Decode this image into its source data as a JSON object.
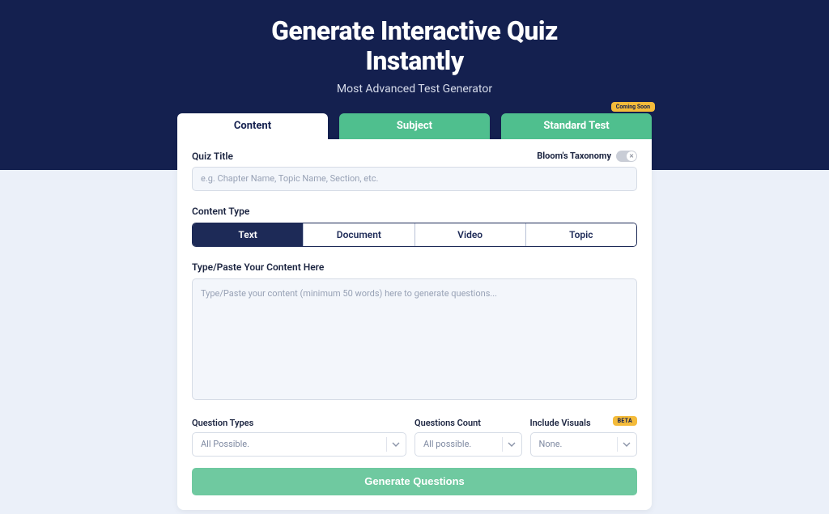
{
  "hero": {
    "title_line1": "Generate Interactive Quiz",
    "title_line2": "Instantly",
    "subtitle": "Most Advanced Test Generator"
  },
  "tabs": {
    "content": "Content",
    "subject": "Subject",
    "standard_test": "Standard Test",
    "coming_soon": "Coming Soon"
  },
  "form": {
    "quiz_title_label": "Quiz Title",
    "quiz_title_placeholder": "e.g. Chapter Name, Topic Name, Section, etc.",
    "bloom_label": "Bloom's Taxonomy",
    "content_type_label": "Content Type",
    "content_types": {
      "text": "Text",
      "document": "Document",
      "video": "Video",
      "topic": "Topic"
    },
    "paste_label": "Type/Paste Your Content Here",
    "paste_placeholder": "Type/Paste your content (minimum 50 words) here to generate questions...",
    "question_types_label": "Question Types",
    "question_types_value": "All Possible.",
    "questions_count_label": "Questions Count",
    "questions_count_value": "All possible.",
    "include_visuals_label": "Include Visuals",
    "include_visuals_value": "None.",
    "beta_badge": "BETA",
    "generate_button": "Generate Questions"
  }
}
